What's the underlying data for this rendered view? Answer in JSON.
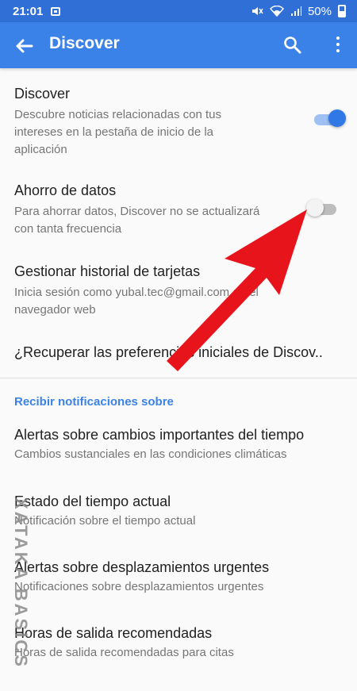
{
  "status_bar": {
    "time": "21:01",
    "battery": "50%",
    "icons": [
      "mail-icon",
      "mute-icon",
      "wifi-icon",
      "signal-icon",
      "battery-icon"
    ]
  },
  "app_bar": {
    "title": "Discover",
    "icons": [
      "back-arrow-icon",
      "search-icon",
      "more-vert-icon"
    ]
  },
  "settings": [
    {
      "title": "Discover",
      "summary": [
        "Descubre noticias relacionadas con tus",
        "intereses en la pestaña de inicio de la",
        "aplicación"
      ],
      "toggle": true
    },
    {
      "title": "Ahorro de datos",
      "summary": [
        "Para ahorrar datos, Discover no se actualizará",
        "con tanta frecuencia"
      ],
      "toggle": false
    },
    {
      "title": "Gestionar historial de tarjetas",
      "summary": [
        "Inicia sesión como yubal.tec@gmail.com en el",
        "navegador web"
      ]
    },
    {
      "title": "¿Recuperar las preferencias iniciales de Discov.."
    }
  ],
  "notifications_section": {
    "header": "Recibir notificaciones sobre",
    "items": [
      {
        "title": "Alertas sobre cambios importantes del tiempo",
        "summary": "Cambios sustanciales en las condiciones climáticas"
      },
      {
        "title": "Estado del tiempo actual",
        "summary": "Notificación sobre el tiempo actual"
      },
      {
        "title": "Alertas sobre desplazamientos urgentes",
        "summary": "Notificaciones sobre desplazamientos urgentes"
      },
      {
        "title": "Horas de salida recomendadas",
        "summary": "Horas de salida recomendadas para citas"
      }
    ]
  },
  "watermark": "XATAKA BASICS",
  "colors": {
    "status_bar": "#2f6fd6",
    "app_bar": "#3b82e8",
    "toggle_on": "#2f78e6",
    "arrow": "#e8141c",
    "section_header": "#3b82e8"
  }
}
